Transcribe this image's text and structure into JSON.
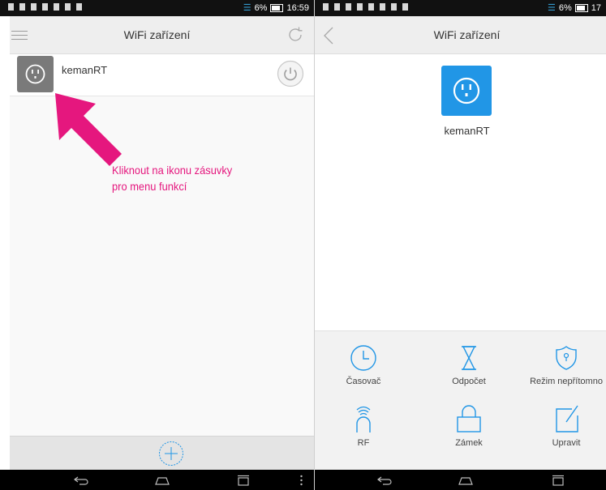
{
  "left_panel": {
    "status_bar": {
      "battery_percent": "6%",
      "time": "16:59"
    },
    "title": "WiFi zařízení",
    "device": {
      "name": "kemanRT"
    },
    "annotation": {
      "line1": "Kliknout na ikonu zásuvky",
      "line2": "pro menu funkcí"
    },
    "icons": [
      "menu-icon",
      "refresh-icon",
      "socket-icon",
      "power-icon",
      "add-icon"
    ]
  },
  "right_panel": {
    "status_bar": {
      "battery_percent": "6%",
      "time": "17"
    },
    "title": "WiFi zařízení",
    "device": {
      "name": "kemanRT"
    },
    "functions": [
      {
        "label": "Časovač",
        "icon": "clock-icon"
      },
      {
        "label": "Odpočet",
        "icon": "hourglass-icon"
      },
      {
        "label": "Režim nepřítomno",
        "icon": "shield-icon"
      },
      {
        "label": "RF",
        "icon": "rf-signal-icon"
      },
      {
        "label": "Zámek",
        "icon": "lock-icon"
      },
      {
        "label": "Upravit",
        "icon": "edit-icon"
      }
    ]
  },
  "colors": {
    "accent": "#2196e6",
    "annotation": "#e5177e",
    "toolbar": "#eeeeee"
  }
}
